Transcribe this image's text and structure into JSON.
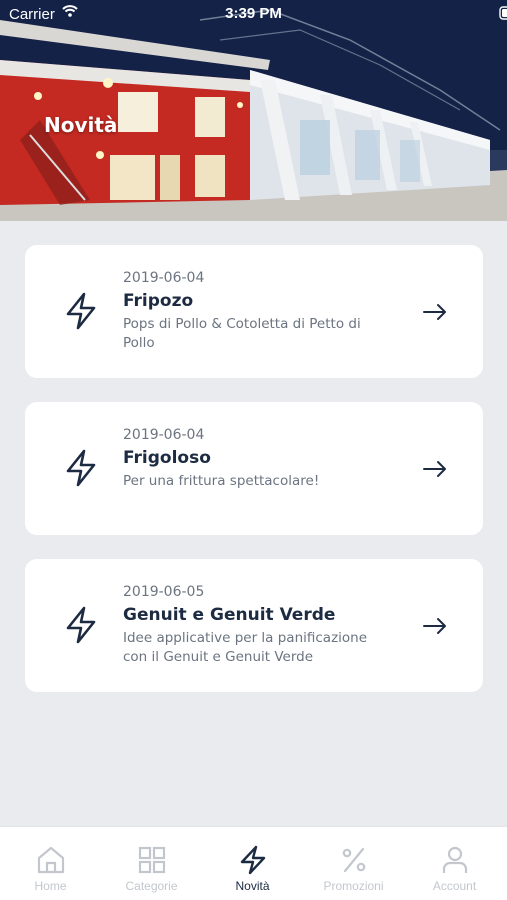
{
  "status_bar": {
    "carrier": "Carrier",
    "time": "3:39 PM"
  },
  "header": {
    "title": "Novità"
  },
  "news": [
    {
      "date": "2019-06-04",
      "title": "Fripozo",
      "description": "Pops di Pollo & Cotoletta di Petto di Pollo",
      "icon": "lightning-icon"
    },
    {
      "date": "2019-06-04",
      "title": "Frigoloso",
      "description": "Per una frittura spettacolare!",
      "icon": "lightning-icon"
    },
    {
      "date": "2019-06-05",
      "title": "Genuit e Genuit Verde",
      "description": "Idee applicative per la panificazione con il Genuit e Genuit Verde",
      "icon": "lightning-icon"
    }
  ],
  "tabbar": {
    "items": [
      {
        "label": "Home",
        "icon": "home-icon",
        "active": false
      },
      {
        "label": "Categorie",
        "icon": "grid-icon",
        "active": false
      },
      {
        "label": "Novità",
        "icon": "lightning-icon",
        "active": true
      },
      {
        "label": "Promozioni",
        "icon": "percent-icon",
        "active": false
      },
      {
        "label": "Account",
        "icon": "user-icon",
        "active": false
      }
    ]
  },
  "colors": {
    "background": "#e9ebee",
    "card": "#ffffff",
    "primary_text": "#1d2b42",
    "muted_text": "#6b7480",
    "inactive_tab": "#c3c7cd"
  }
}
